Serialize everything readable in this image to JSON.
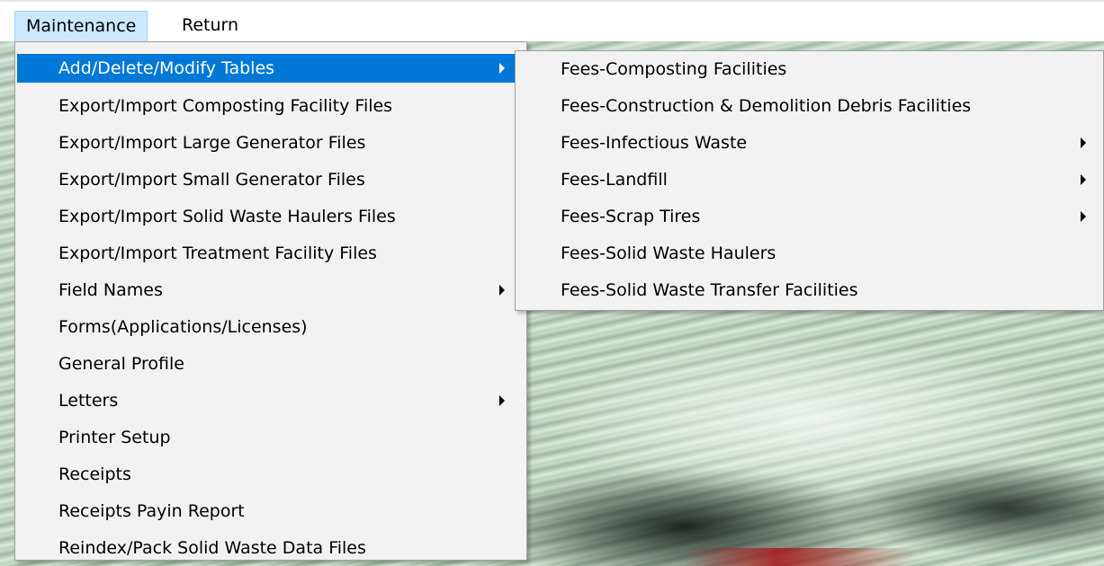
{
  "menubar": {
    "items": [
      {
        "label": "Maintenance",
        "open": true
      },
      {
        "label": "Return",
        "open": false
      }
    ]
  },
  "dropdown": {
    "items": [
      {
        "label": "Add/Delete/Modify Tables",
        "submenu": true,
        "selected": true
      },
      {
        "label": "Export/Import Composting Facility Files",
        "submenu": false
      },
      {
        "label": "Export/Import Large Generator Files",
        "submenu": false
      },
      {
        "label": "Export/Import Small Generator Files",
        "submenu": false
      },
      {
        "label": "Export/Import Solid Waste Haulers Files",
        "submenu": false
      },
      {
        "label": "Export/Import Treatment Facility Files",
        "submenu": false
      },
      {
        "label": "Field Names",
        "submenu": true
      },
      {
        "label": "Forms(Applications/Licenses)",
        "submenu": false
      },
      {
        "label": "General Profile",
        "submenu": false
      },
      {
        "label": "Letters",
        "submenu": true
      },
      {
        "label": "Printer Setup",
        "submenu": false
      },
      {
        "label": "Receipts",
        "submenu": false
      },
      {
        "label": "Receipts Payin Report",
        "submenu": false
      },
      {
        "label": "Reindex/Pack Solid Waste Data Files",
        "submenu": false
      }
    ]
  },
  "submenu": {
    "items": [
      {
        "label": "Fees-Composting Facilities",
        "submenu": false
      },
      {
        "label": "Fees-Construction & Demolition Debris Facilities",
        "submenu": false
      },
      {
        "label": "Fees-Infectious Waste",
        "submenu": true
      },
      {
        "label": "Fees-Landfill",
        "submenu": true
      },
      {
        "label": "Fees-Scrap Tires",
        "submenu": true
      },
      {
        "label": "Fees-Solid Waste Haulers",
        "submenu": false
      },
      {
        "label": "Fees-Solid Waste Transfer Facilities",
        "submenu": false
      }
    ]
  },
  "colors": {
    "menu_bg": "#f2f2f2",
    "selection": "#0078d7",
    "menubar_open": "#cce8ff"
  }
}
